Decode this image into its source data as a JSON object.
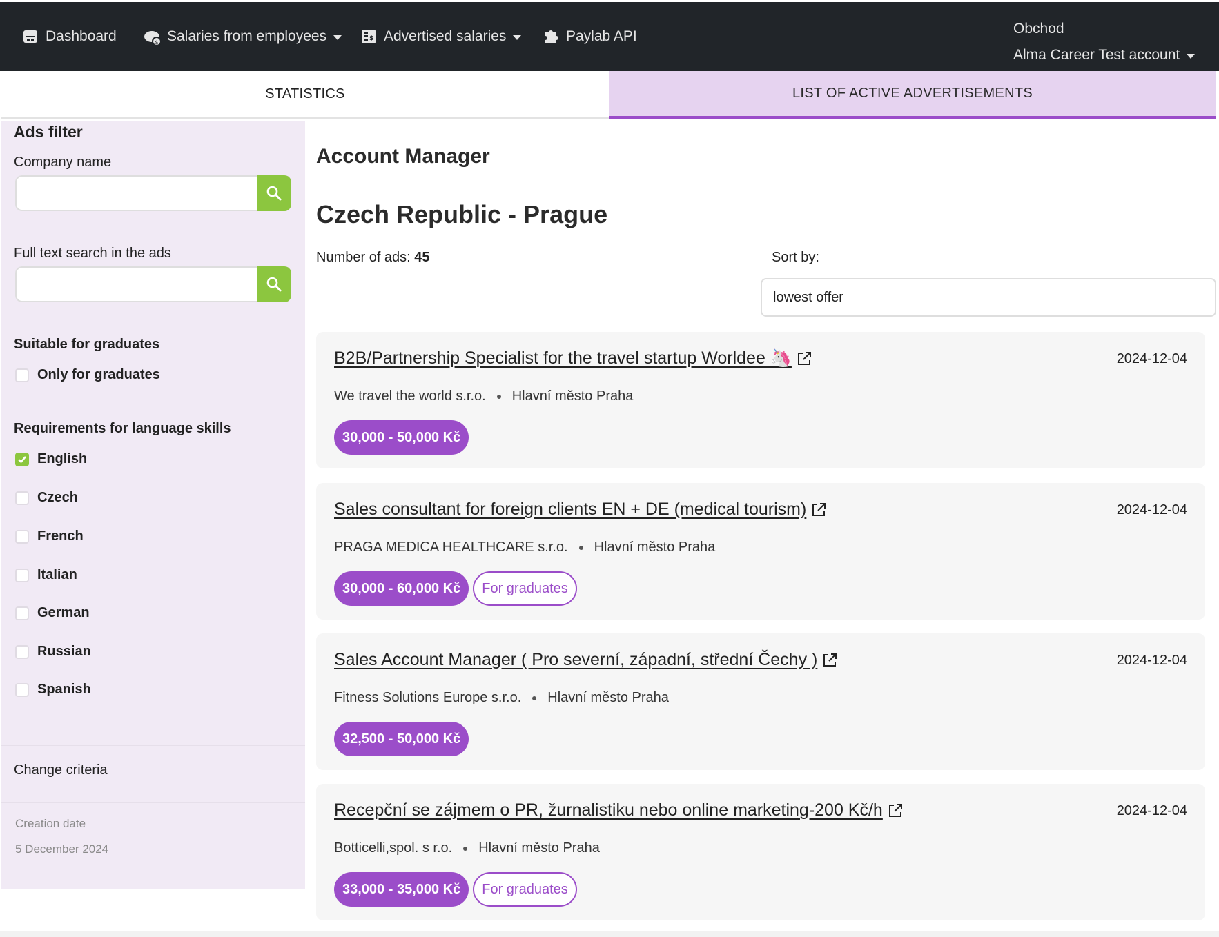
{
  "nav": {
    "items": [
      {
        "label": "Dashboard",
        "icon": "dashboard-icon",
        "dropdown": false
      },
      {
        "label": "Salaries from employees",
        "icon": "salary-cloud-icon",
        "dropdown": true
      },
      {
        "label": "Advertised salaries",
        "icon": "advert-icon",
        "dropdown": true
      },
      {
        "label": "Paylab API",
        "icon": "puzzle-icon",
        "dropdown": false
      }
    ],
    "account": {
      "company": "Obchod",
      "name": "Alma Career Test account"
    }
  },
  "tabs": [
    {
      "label": "STATISTICS",
      "active": false
    },
    {
      "label": "LIST OF ACTIVE ADVERTISEMENTS",
      "active": true
    }
  ],
  "sidebar": {
    "title": "Ads filter",
    "company_label": "Company name",
    "company_value": "",
    "fulltext_label": "Full text search in the ads",
    "fulltext_value": "",
    "graduates_heading": "Suitable for graduates",
    "graduates_option": "Only for graduates",
    "language_heading": "Requirements for language skills",
    "languages": [
      {
        "label": "English",
        "checked": true
      },
      {
        "label": "Czech",
        "checked": false
      },
      {
        "label": "French",
        "checked": false
      },
      {
        "label": "Italian",
        "checked": false
      },
      {
        "label": "German",
        "checked": false
      },
      {
        "label": "Russian",
        "checked": false
      },
      {
        "label": "Spanish",
        "checked": false
      }
    ],
    "change_criteria": "Change criteria",
    "creation_label": "Creation date",
    "creation_date": "5 December 2024"
  },
  "main": {
    "title": "Account Manager",
    "subtitle": "Czech Republic - Prague",
    "ads_count_label": "Number of ads:",
    "ads_count": "45",
    "sort_label": "Sort by:",
    "sort_value": "lowest offer",
    "ads": [
      {
        "title": "B2B/Partnership Specialist for the travel startup Worldee 🦄",
        "date": "2024-12-04",
        "company": "We travel the world s.r.o.",
        "location": "Hlavní město Praha",
        "salary": "30,000 - 50,000 Kč",
        "graduates": ""
      },
      {
        "title": "Sales consultant for foreign clients EN + DE (medical tourism)",
        "date": "2024-12-04",
        "company": "PRAGA MEDICA HEALTHCARE s.r.o.",
        "location": "Hlavní město Praha",
        "salary": "30,000 - 60,000 Kč",
        "graduates": "For graduates"
      },
      {
        "title": "Sales Account Manager ( Pro severní, západní, střední Čechy )",
        "date": "2024-12-04",
        "company": "Fitness Solutions Europe s.r.o.",
        "location": "Hlavní město Praha",
        "salary": "32,500 - 50,000 Kč",
        "graduates": ""
      },
      {
        "title": "Recepční se zájmem o PR, žurnalistiku nebo online marketing-200 Kč/h",
        "date": "2024-12-04",
        "company": "Botticelli,spol. s r.o.",
        "location": "Hlavní město Praha",
        "salary": "33,000 - 35,000 Kč",
        "graduates": "For graduates"
      }
    ]
  },
  "colors": {
    "navbar": "#212529",
    "accent": "#9b4dc9",
    "green": "#8cc63f",
    "sidebar": "#f1eaf5"
  }
}
